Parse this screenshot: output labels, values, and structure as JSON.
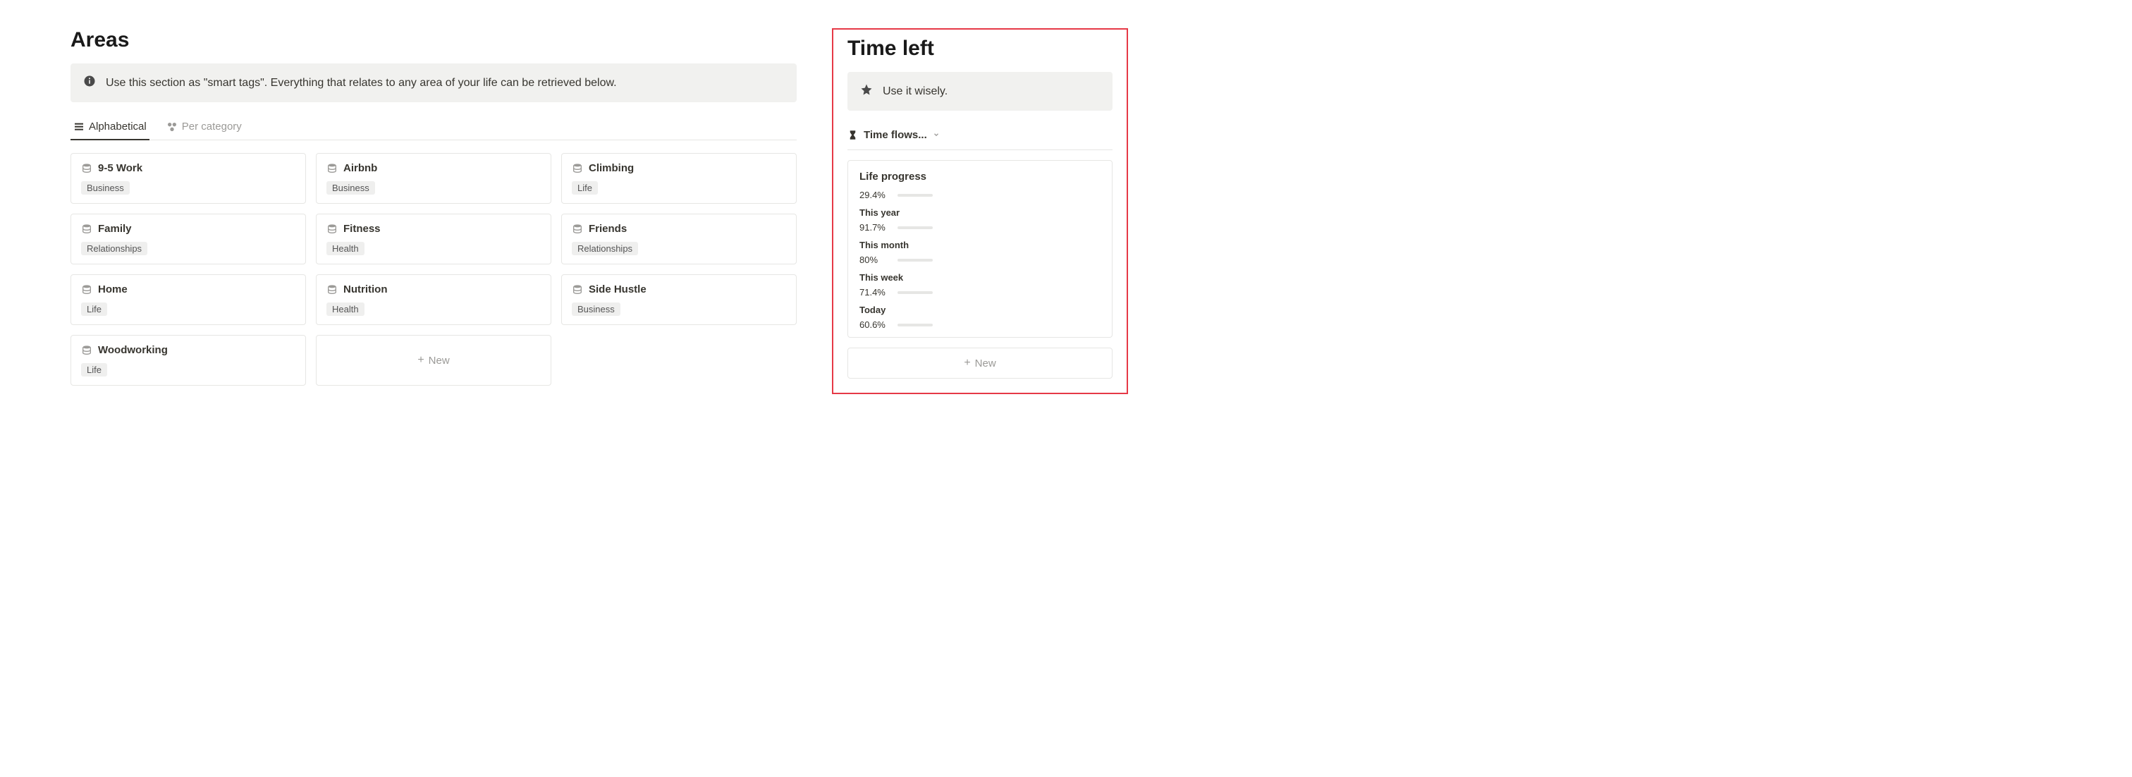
{
  "areas": {
    "title": "Areas",
    "callout": "Use this section as \"smart tags\". Everything that relates to any area of your life can be retrieved below.",
    "tabs": [
      {
        "label": "Alphabetical",
        "active": true
      },
      {
        "label": "Per category",
        "active": false
      }
    ],
    "cards": [
      {
        "title": "9-5 Work",
        "tag": "Business"
      },
      {
        "title": "Airbnb",
        "tag": "Business"
      },
      {
        "title": "Climbing",
        "tag": "Life"
      },
      {
        "title": "Family",
        "tag": "Relationships"
      },
      {
        "title": "Fitness",
        "tag": "Health"
      },
      {
        "title": "Friends",
        "tag": "Relationships"
      },
      {
        "title": "Home",
        "tag": "Life"
      },
      {
        "title": "Nutrition",
        "tag": "Health"
      },
      {
        "title": "Side Hustle",
        "tag": "Business"
      },
      {
        "title": "Woodworking",
        "tag": "Life"
      }
    ],
    "new_label": "New"
  },
  "time_left": {
    "title": "Time left",
    "callout": "Use it wisely.",
    "toggle_label": "Time flows...",
    "card_title": "Life progress",
    "items": [
      {
        "label": "",
        "pct_text": "29.4%",
        "pct": 29.4,
        "color": "#2f8f5b"
      },
      {
        "label": "This year",
        "pct_text": "91.7%",
        "pct": 91.7,
        "color": "#d84f8f"
      },
      {
        "label": "This month",
        "pct_text": "80%",
        "pct": 80,
        "color": "#e07b2e"
      },
      {
        "label": "This week",
        "pct_text": "71.4%",
        "pct": 71.4,
        "color": "#3a7bd5"
      },
      {
        "label": "Today",
        "pct_text": "60.6%",
        "pct": 60.6,
        "color": "#d4a017"
      }
    ],
    "new_label": "New"
  }
}
